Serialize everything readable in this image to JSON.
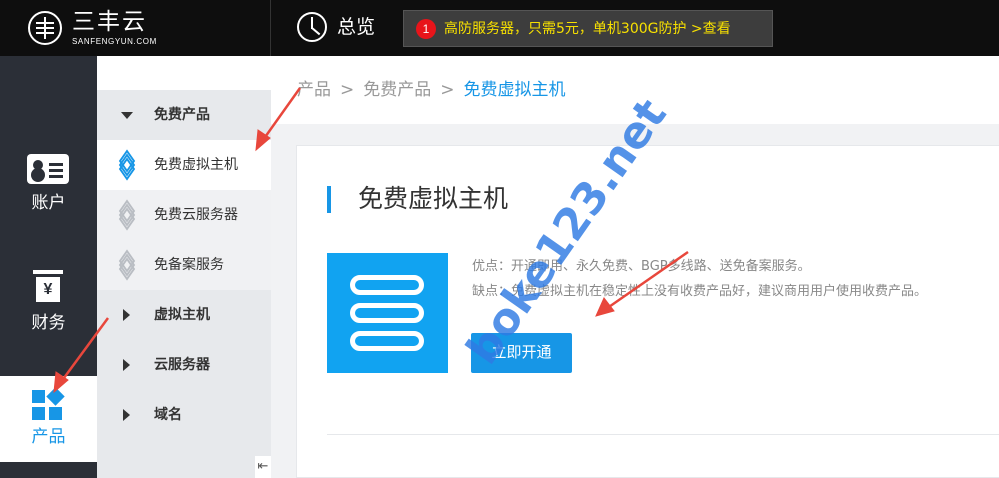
{
  "topbar": {
    "logo_text": "三丰云",
    "logo_sub": "SANFENGYUN.COM",
    "overview_label": "总览",
    "promo_number": "1",
    "promo_text": "高防服务器，只需5元，单机300G防护  >查看"
  },
  "sidebar": {
    "items": [
      {
        "label": "账户",
        "icon": "account-card-icon"
      },
      {
        "label": "财务",
        "icon": "yen-icon"
      },
      {
        "label": "产品",
        "icon": "product-grid-icon",
        "active": true
      }
    ]
  },
  "subnav": {
    "items": [
      {
        "label": "免费产品",
        "type": "group-expanded"
      },
      {
        "label": "免费虚拟主机",
        "type": "item",
        "active": true
      },
      {
        "label": "免费云服务器",
        "type": "item"
      },
      {
        "label": "免备案服务",
        "type": "item"
      },
      {
        "label": "虚拟主机",
        "type": "group-collapsed"
      },
      {
        "label": "云服务器",
        "type": "group-collapsed"
      },
      {
        "label": "域名",
        "type": "group-collapsed"
      }
    ],
    "collapse_glyph": "⇤"
  },
  "breadcrumb": {
    "items": [
      "产品",
      "免费产品",
      "免费虚拟主机"
    ],
    "separator": ">"
  },
  "card": {
    "title": "免费虚拟主机",
    "pros": "优点：开通即用、永久免费、BGP多线路、送免备案服务。",
    "cons": "缺点：免费虚拟主机在稳定性上没有收费产品好，建议商用用户使用收费产品。",
    "button_label": "立即开通"
  },
  "watermark": "boke123.net",
  "colors": {
    "accent": "#1796e6",
    "topbar": "#0e0e0e",
    "sidebar": "#2b2f37",
    "promo_text": "#f7e000",
    "arrow": "#e8473c"
  }
}
